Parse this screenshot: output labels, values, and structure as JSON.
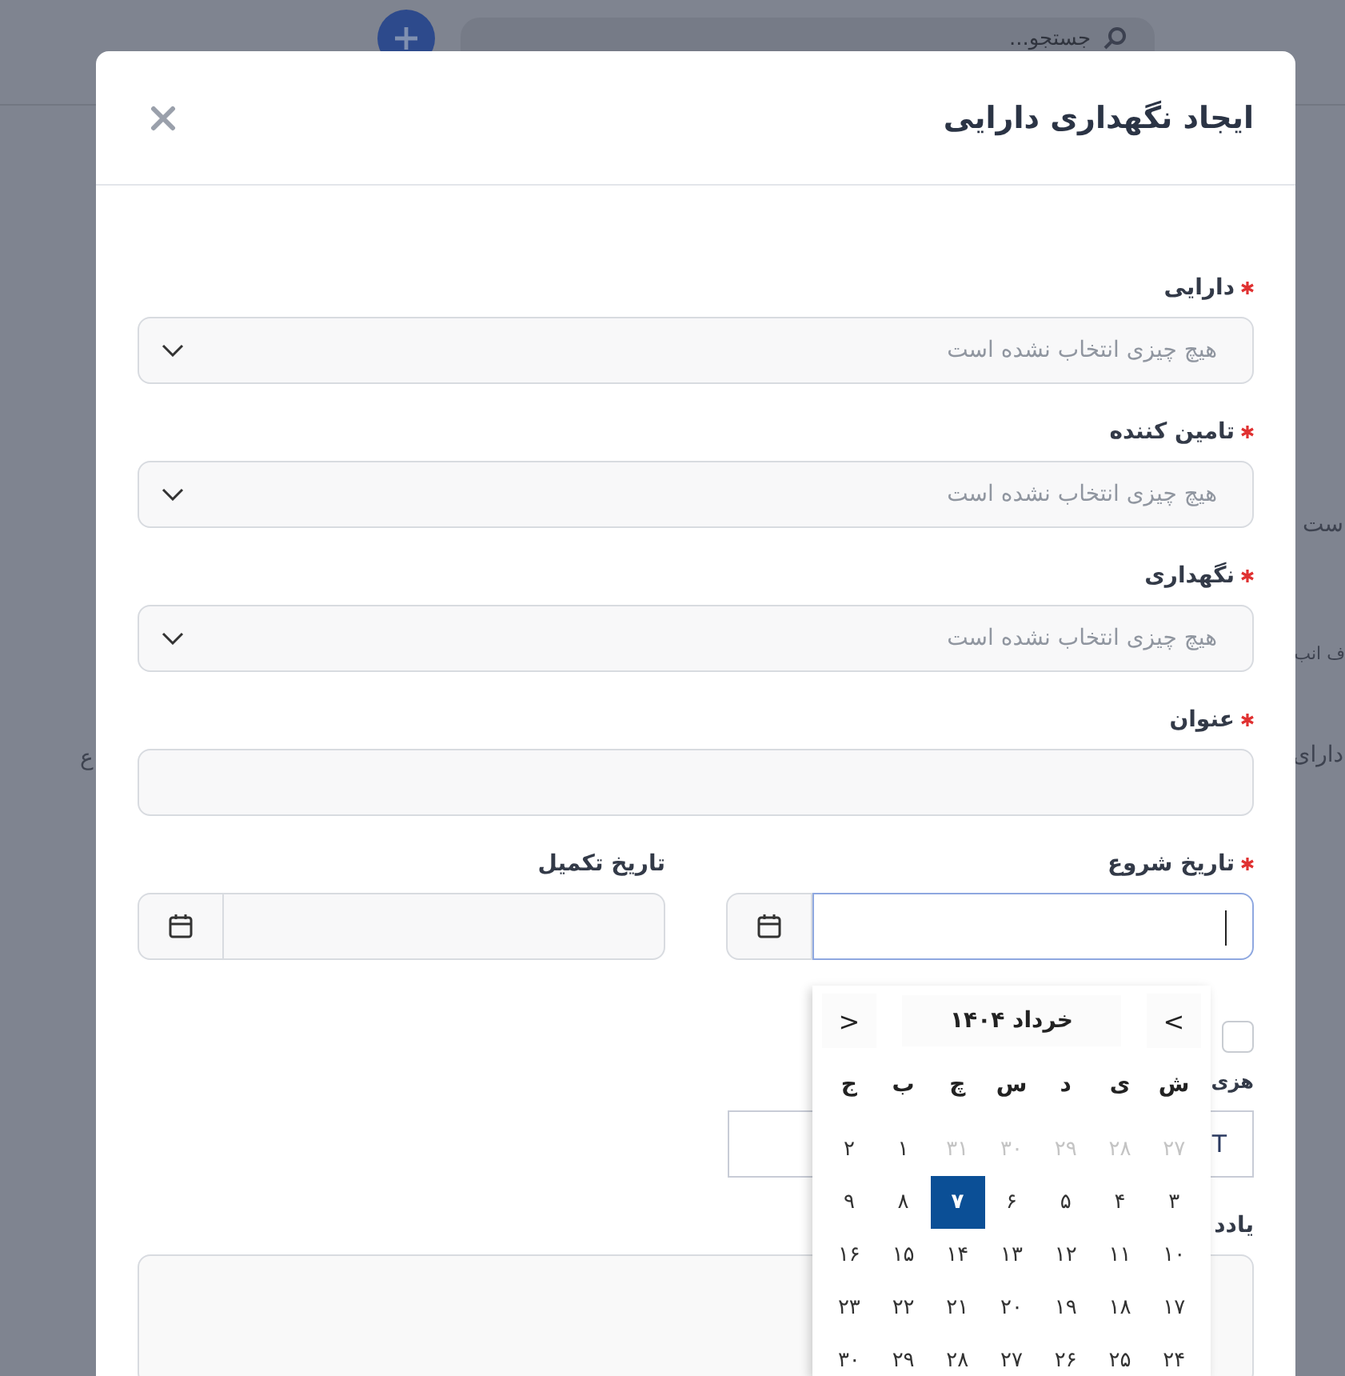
{
  "backdrop": {
    "search": {
      "placeholder": "جستجو..."
    },
    "fragments": [
      {
        "text": "ست"
      },
      {
        "text": "ف انب"
      },
      {
        "text": "دارای"
      },
      {
        "text": "ع"
      }
    ]
  },
  "modal": {
    "title": "ایجاد نگهداری دارایی",
    "fields": [
      {
        "kind": "select",
        "label": "دارایی",
        "required": true,
        "placeholder": "هیچ چیزی انتخاب نشده است"
      },
      {
        "kind": "select",
        "label": "تامین کننده",
        "required": true,
        "placeholder": "هیچ چیزی انتخاب نشده است"
      },
      {
        "kind": "select",
        "label": "نگهداری",
        "required": true,
        "placeholder": "هیچ چیزی انتخاب نشده است"
      },
      {
        "kind": "text",
        "label": "عنوان",
        "required": true
      },
      {
        "kind": "dates",
        "items": [
          {
            "label": "تاریخ شروع",
            "required": true,
            "focused": true
          },
          {
            "label": "تاریخ تکمیل",
            "required": false,
            "focused": false
          }
        ]
      },
      {
        "kind": "checkbox",
        "checked": false
      },
      {
        "kind": "money",
        "label": "هزی",
        "value": "T"
      },
      {
        "kind": "textarea",
        "label": "یادد"
      }
    ]
  },
  "calendar": {
    "prev": "<",
    "title": "خرداد ۱۴۰۴",
    "next": ">",
    "weekdays": [
      "ش",
      "ی",
      "د",
      "س",
      "چ",
      "ب",
      "ج"
    ],
    "weeks": [
      [
        {
          "day": "۲۷",
          "outside": true,
          "selected": false
        },
        {
          "day": "۲۸",
          "outside": true,
          "selected": false
        },
        {
          "day": "۲۹",
          "outside": true,
          "selected": false
        },
        {
          "day": "۳۰",
          "outside": true,
          "selected": false
        },
        {
          "day": "۳۱",
          "outside": true,
          "selected": false
        },
        {
          "day": "۱",
          "outside": false,
          "selected": false
        },
        {
          "day": "۲",
          "outside": false,
          "selected": false
        }
      ],
      [
        {
          "day": "۳",
          "outside": false,
          "selected": false
        },
        {
          "day": "۴",
          "outside": false,
          "selected": false
        },
        {
          "day": "۵",
          "outside": false,
          "selected": false
        },
        {
          "day": "۶",
          "outside": false,
          "selected": false
        },
        {
          "day": "۷",
          "outside": false,
          "selected": true
        },
        {
          "day": "۸",
          "outside": false,
          "selected": false
        },
        {
          "day": "۹",
          "outside": false,
          "selected": false
        }
      ],
      [
        {
          "day": "۱۰",
          "outside": false,
          "selected": false
        },
        {
          "day": "۱۱",
          "outside": false,
          "selected": false
        },
        {
          "day": "۱۲",
          "outside": false,
          "selected": false
        },
        {
          "day": "۱۳",
          "outside": false,
          "selected": false
        },
        {
          "day": "۱۴",
          "outside": false,
          "selected": false
        },
        {
          "day": "۱۵",
          "outside": false,
          "selected": false
        },
        {
          "day": "۱۶",
          "outside": false,
          "selected": false
        }
      ],
      [
        {
          "day": "۱۷",
          "outside": false,
          "selected": false
        },
        {
          "day": "۱۸",
          "outside": false,
          "selected": false
        },
        {
          "day": "۱۹",
          "outside": false,
          "selected": false
        },
        {
          "day": "۲۰",
          "outside": false,
          "selected": false
        },
        {
          "day": "۲۱",
          "outside": false,
          "selected": false
        },
        {
          "day": "۲۲",
          "outside": false,
          "selected": false
        },
        {
          "day": "۲۳",
          "outside": false,
          "selected": false
        }
      ],
      [
        {
          "day": "۲۴",
          "outside": false,
          "selected": false
        },
        {
          "day": "۲۵",
          "outside": false,
          "selected": false
        },
        {
          "day": "۲۶",
          "outside": false,
          "selected": false
        },
        {
          "day": "۲۷",
          "outside": false,
          "selected": false
        },
        {
          "day": "۲۸",
          "outside": false,
          "selected": false
        },
        {
          "day": "۲۹",
          "outside": false,
          "selected": false
        },
        {
          "day": "۳۰",
          "outside": false,
          "selected": false
        }
      ]
    ]
  }
}
